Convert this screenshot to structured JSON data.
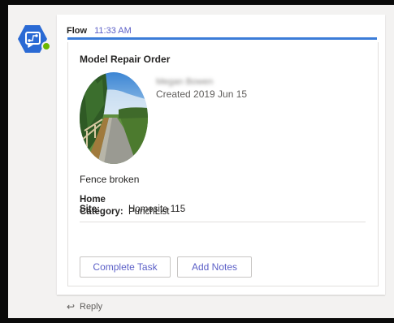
{
  "message": {
    "sender": "Flow",
    "time": "11:33 AM",
    "accent_color": "#3b7cd8",
    "time_color": "#5b5fc7"
  },
  "card": {
    "title": "Model Repair Order",
    "user_name": "Megan Bowen",
    "created": "Created 2019 Jun 15",
    "description": "Fence broken",
    "facts": [
      {
        "label": "Home Site:",
        "value": "Homesite 115"
      },
      {
        "label": "Category:",
        "value": "PunchList"
      }
    ],
    "actions": [
      {
        "label": "Complete Task"
      },
      {
        "label": "Add Notes"
      }
    ]
  },
  "reply": {
    "label": "Reply",
    "icon": "reply-arrow-icon"
  },
  "avatar": {
    "icon": "flow-bot-icon",
    "color": "#2a6ad4",
    "status_color": "#6bb700"
  }
}
